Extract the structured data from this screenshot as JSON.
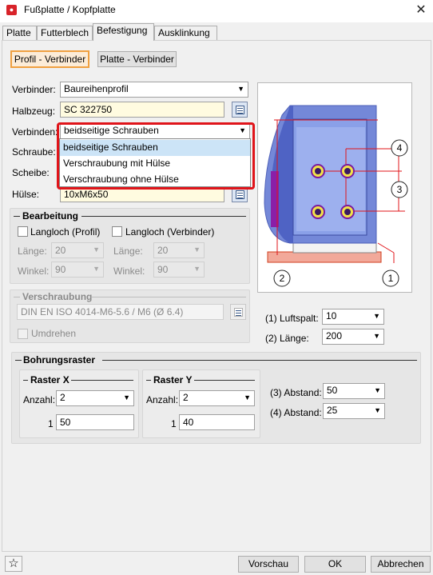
{
  "window": {
    "title": "Fußplatte / Kopfplatte",
    "close_glyph": "✕"
  },
  "tabs": [
    "Platte",
    "Futterblech",
    "Befestigung",
    "Ausklinkung"
  ],
  "active_tab": "Befestigung",
  "mode_buttons": {
    "profil": "Profil - Verbinder",
    "platte": "Platte - Verbinder"
  },
  "fields": {
    "verbinder_label": "Verbinder:",
    "verbinder_value": "Baureihenprofil",
    "halbzeug_label": "Halbzeug:",
    "halbzeug_value": "SC  322750",
    "verbinden_label": "Verbinden:",
    "verbinden_value": "beidseitige Schrauben",
    "schraube_label": "Schraube:",
    "scheibe_label": "Scheibe:",
    "huelse_label": "Hülse:",
    "huelse_value": "10xM6x50"
  },
  "dropdown_options": [
    "beidseitige Schrauben",
    "Verschraubung mit Hülse",
    "Verschraubung ohne Hülse"
  ],
  "bearbeitung": {
    "title": "Bearbeitung",
    "langloch_profil": "Langloch (Profil)",
    "langloch_verbinder": "Langloch (Verbinder)",
    "laenge_label": "Länge:",
    "winkel_label": "Winkel:",
    "laenge_profil": "20",
    "winkel_profil": "90",
    "laenge_verbinder": "20",
    "winkel_verbinder": "90"
  },
  "verschraubung": {
    "title": "Verschraubung",
    "value": "DIN EN ISO 4014-M6-5.6 / M6 (Ø 6.4)",
    "umdrehen": "Umdrehen"
  },
  "preview_params": {
    "luftspalt_label": "(1) Luftspalt:",
    "luftspalt_value": "10",
    "laenge_label": "(2) Länge:",
    "laenge_value": "200"
  },
  "preview_callouts": [
    "4",
    "3",
    "2",
    "1"
  ],
  "bohrungsraster": {
    "title": "Bohrungsraster",
    "raster_x": {
      "title": "Raster X",
      "anzahl_label": "Anzahl:",
      "anzahl_value": "2",
      "row_index": "1",
      "row_value": "50"
    },
    "raster_y": {
      "title": "Raster Y",
      "anzahl_label": "Anzahl:",
      "anzahl_value": "2",
      "row_index": "1",
      "row_value": "40"
    },
    "abstand3_label": "(3) Abstand:",
    "abstand3_value": "50",
    "abstand4_label": "(4) Abstand:",
    "abstand4_value": "25"
  },
  "footer": {
    "vorschau": "Vorschau",
    "ok": "OK",
    "abbrechen": "Abbrechen"
  },
  "colors": {
    "accent_red": "#e0141a",
    "selection_blue": "#cce4f7",
    "field_yellow": "#fffbe0",
    "plate_pink": "#f2a99a",
    "profile_blue": "#5c72d0",
    "profile_purple": "#8a1fa8"
  }
}
